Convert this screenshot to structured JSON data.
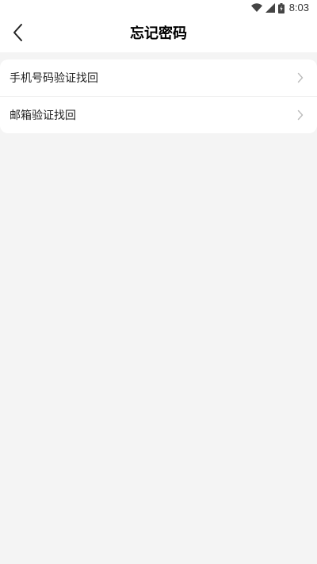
{
  "status_bar": {
    "time": "8:03",
    "icons": [
      "wifi-icon",
      "signal-icon",
      "battery-icon"
    ]
  },
  "header": {
    "title": "忘记密码",
    "back_icon": "back-arrow-icon"
  },
  "menu": {
    "items": [
      {
        "label": "手机号码验证找回",
        "icon": "chevron-right-icon"
      },
      {
        "label": "邮箱验证找回",
        "icon": "chevron-right-icon"
      }
    ]
  },
  "colors": {
    "background": "#f4f4f4",
    "surface": "#ffffff",
    "text": "#222222",
    "chevron": "#bbbbbb"
  }
}
